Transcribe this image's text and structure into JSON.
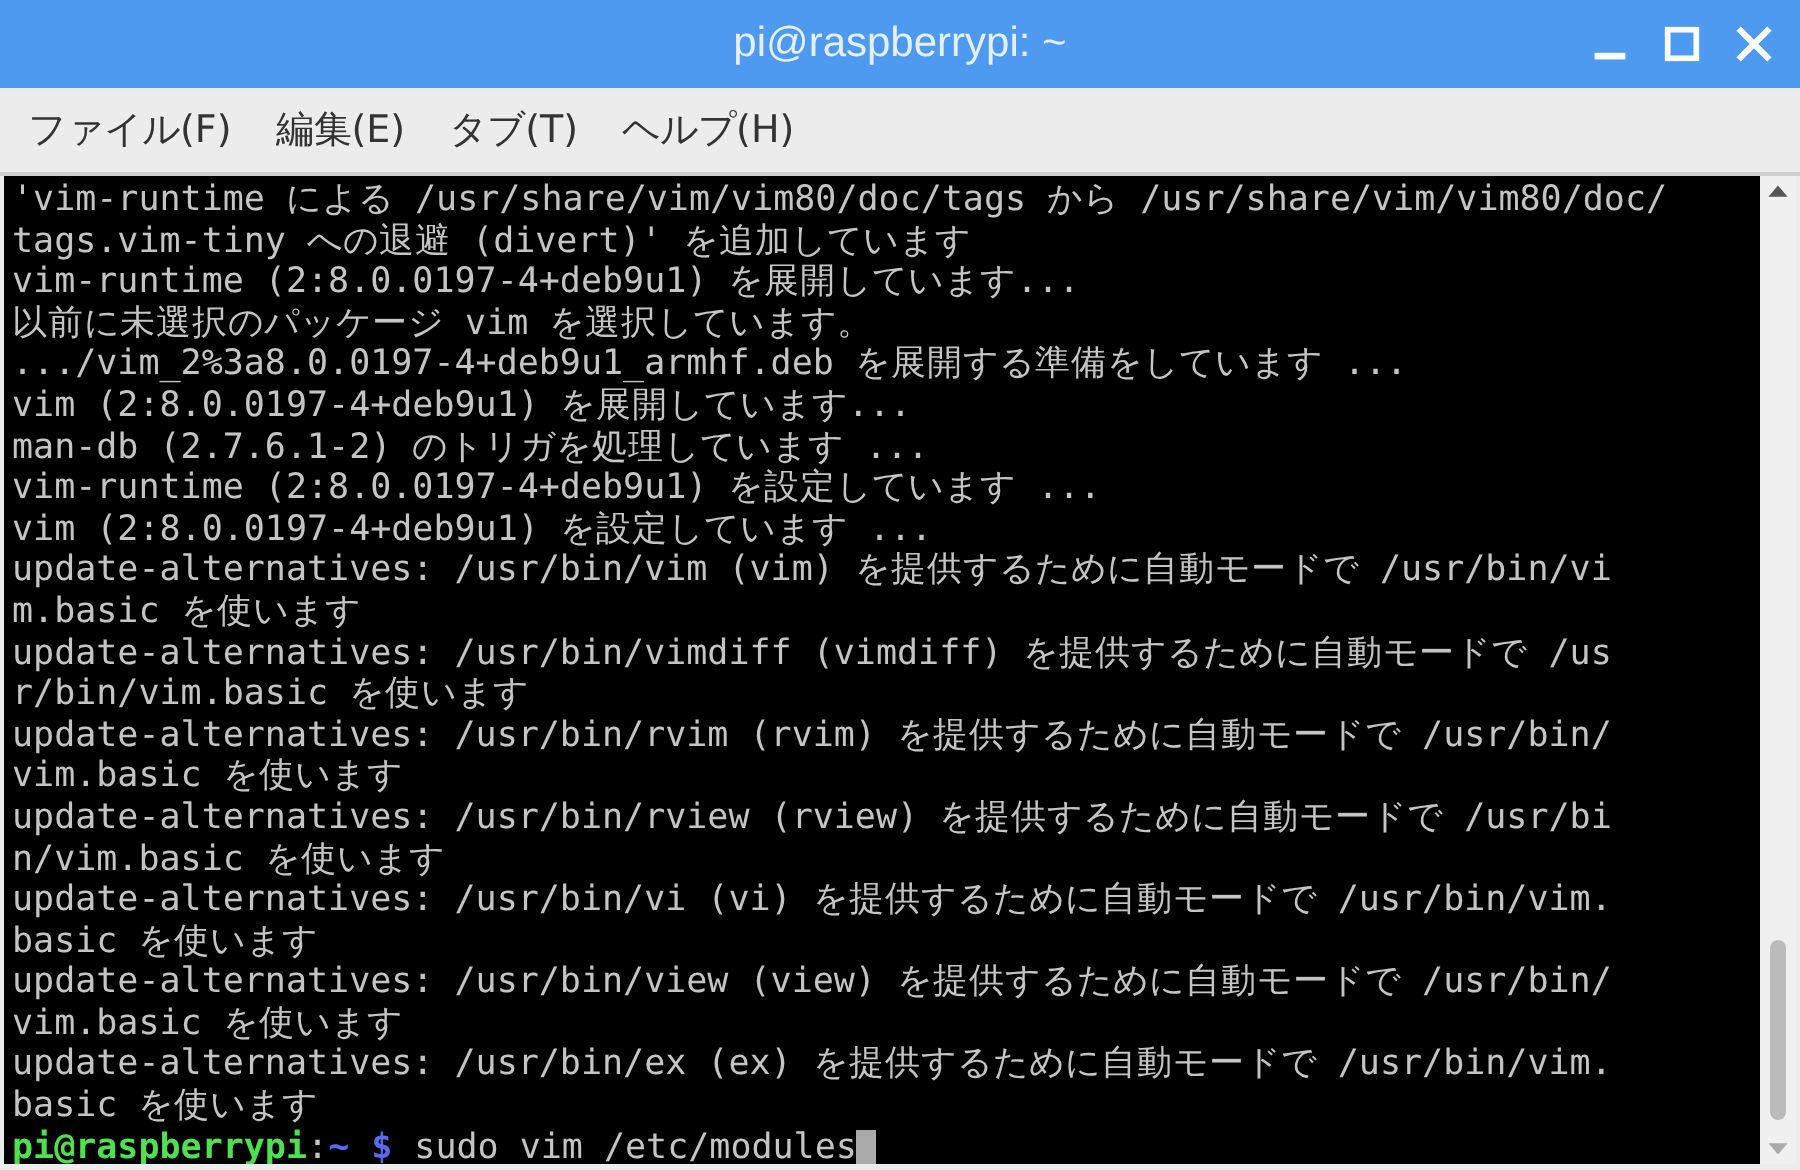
{
  "window": {
    "title": "pi@raspberrypi: ~"
  },
  "menu": [
    {
      "label": "ファイル(F)"
    },
    {
      "label": "編集(E)"
    },
    {
      "label": "タブ(T)"
    },
    {
      "label": "ヘルプ(H)"
    }
  ],
  "terminal": {
    "lines": [
      "'vim-runtime による /usr/share/vim/vim80/doc/tags から /usr/share/vim/vim80/doc/",
      "tags.vim-tiny への退避 (divert)' を追加しています",
      "vim-runtime (2:8.0.0197-4+deb9u1) を展開しています...",
      "以前に未選択のパッケージ vim を選択しています。",
      ".../vim_2%3a8.0.0197-4+deb9u1_armhf.deb を展開する準備をしています ...",
      "vim (2:8.0.0197-4+deb9u1) を展開しています...",
      "man-db (2.7.6.1-2) のトリガを処理しています ...",
      "vim-runtime (2:8.0.0197-4+deb9u1) を設定しています ...",
      "vim (2:8.0.0197-4+deb9u1) を設定しています ...",
      "update-alternatives: /usr/bin/vim (vim) を提供するために自動モードで /usr/bin/vi",
      "m.basic を使います",
      "update-alternatives: /usr/bin/vimdiff (vimdiff) を提供するために自動モードで /us",
      "r/bin/vim.basic を使います",
      "update-alternatives: /usr/bin/rvim (rvim) を提供するために自動モードで /usr/bin/",
      "vim.basic を使います",
      "update-alternatives: /usr/bin/rview (rview) を提供するために自動モードで /usr/bi",
      "n/vim.basic を使います",
      "update-alternatives: /usr/bin/vi (vi) を提供するために自動モードで /usr/bin/vim.",
      "basic を使います",
      "update-alternatives: /usr/bin/view (view) を提供するために自動モードで /usr/bin/",
      "vim.basic を使います",
      "update-alternatives: /usr/bin/ex (ex) を提供するために自動モードで /usr/bin/vim.",
      "basic を使います"
    ],
    "prompt": {
      "user_host": "pi@raspberrypi",
      "separator": ":",
      "cwd": "~",
      "symbol": "$",
      "command": "sudo vim /etc/modules"
    }
  }
}
